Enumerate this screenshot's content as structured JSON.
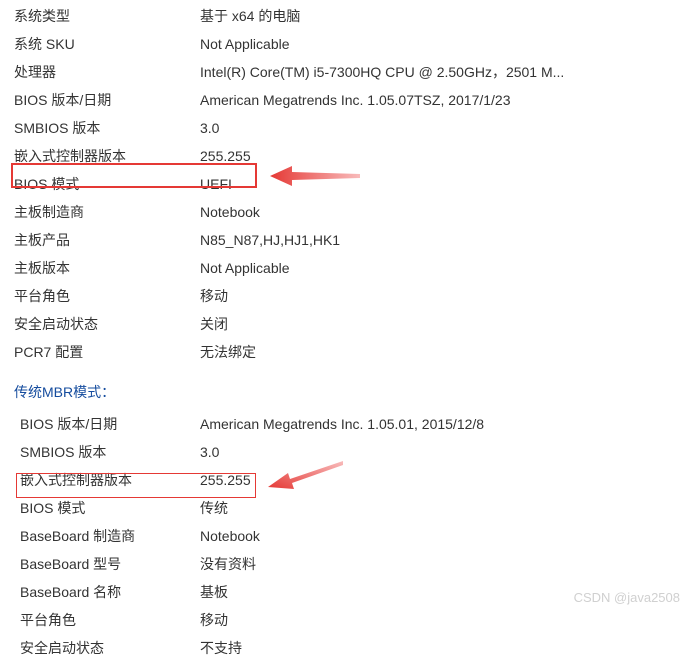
{
  "top": {
    "rows": [
      {
        "label": "系统类型",
        "value": "基于 x64 的电脑"
      },
      {
        "label": "系统 SKU",
        "value": "Not Applicable"
      },
      {
        "label": "处理器",
        "value": "Intel(R) Core(TM) i5-7300HQ CPU @ 2.50GHz，2501 M..."
      },
      {
        "label": "BIOS 版本/日期",
        "value": "American Megatrends Inc. 1.05.07TSZ, 2017/1/23"
      },
      {
        "label": "SMBIOS 版本",
        "value": "3.0"
      },
      {
        "label": "嵌入式控制器版本",
        "value": "255.255"
      },
      {
        "label": "BIOS 模式",
        "value": "UEFI"
      },
      {
        "label": "主板制造商",
        "value": "Notebook"
      },
      {
        "label": "主板产品",
        "value": "N85_N87,HJ,HJ1,HK1"
      },
      {
        "label": "主板版本",
        "value": "Not Applicable"
      },
      {
        "label": "平台角色",
        "value": "移动"
      },
      {
        "label": "安全启动状态",
        "value": "关闭"
      },
      {
        "label": "PCR7 配置",
        "value": "无法绑定"
      }
    ]
  },
  "section_title": "传统MBR模式：",
  "bottom": {
    "rows": [
      {
        "label": "BIOS 版本/日期",
        "value": "American Megatrends Inc. 1.05.01, 2015/12/8"
      },
      {
        "label": "SMBIOS 版本",
        "value": "3.0"
      },
      {
        "label": "嵌入式控制器版本",
        "value": "255.255"
      },
      {
        "label": "BIOS 模式",
        "value": "传统"
      },
      {
        "label": "BaseBoard 制造商",
        "value": "Notebook"
      },
      {
        "label": "BaseBoard 型号",
        "value": "没有资料"
      },
      {
        "label": "BaseBoard 名称",
        "value": "基板"
      },
      {
        "label": "平台角色",
        "value": "移动"
      },
      {
        "label": "安全启动状态",
        "value": "不支持"
      }
    ]
  },
  "watermark": "CSDN @java2508"
}
